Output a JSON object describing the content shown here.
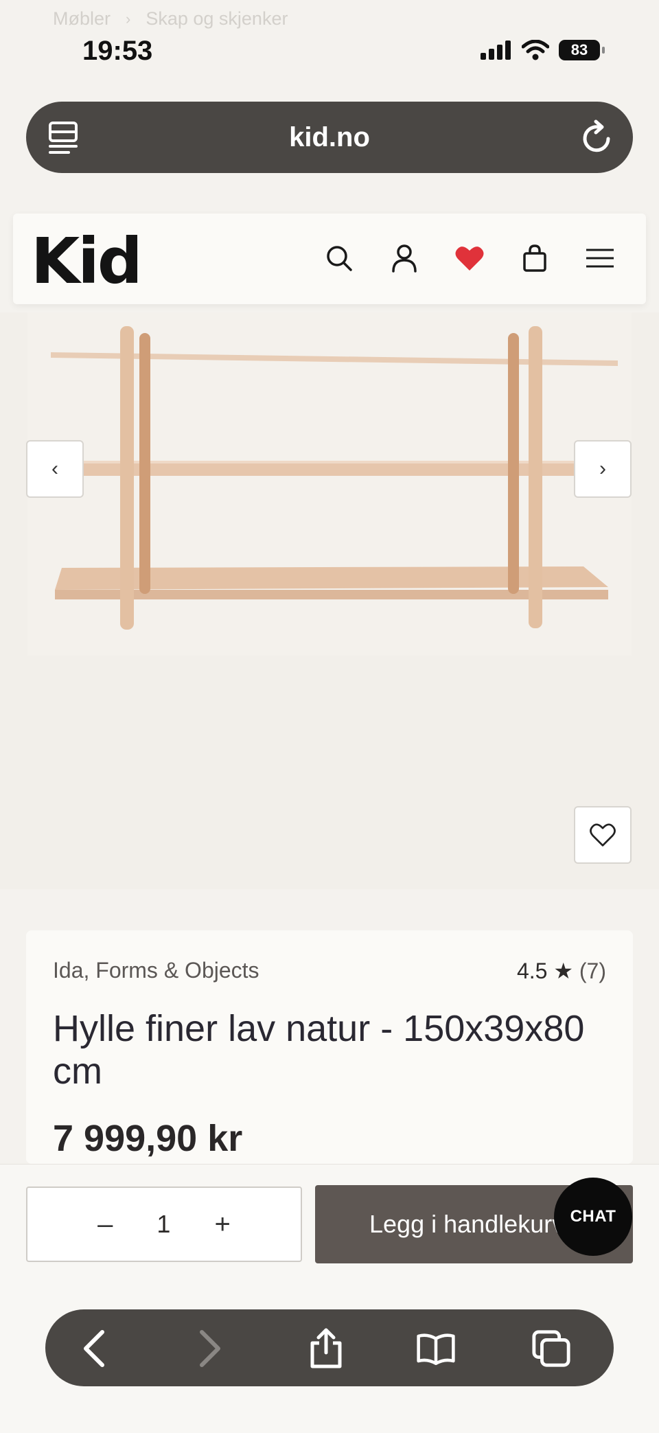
{
  "breadcrumb": {
    "items": [
      "Møbler",
      "Skap og skjenker"
    ],
    "separator": "›"
  },
  "status_bar": {
    "time": "19:53",
    "battery": "83"
  },
  "browser": {
    "url": "kid.no"
  },
  "site_header": {
    "logo": "Kid",
    "icons": [
      "search-icon",
      "account-icon",
      "heart-icon",
      "bag-icon",
      "menu-icon"
    ],
    "heart_color": "#e0323a"
  },
  "gallery": {
    "prev_label": "‹",
    "next_label": "›"
  },
  "product": {
    "brand": "Ida, Forms & Objects",
    "rating_value": "4.5 ★",
    "rating_count": "(7)",
    "title": "Hylle finer lav natur - 150x39x80 cm",
    "price": "7 999,90 kr"
  },
  "purchase": {
    "minus": "–",
    "quantity": "1",
    "plus": "+",
    "add_to_cart": "Legg i handlekurv",
    "chat": "CHAT"
  },
  "colors": {
    "accent_button": "#5e5753",
    "browser_bar": "#4a4744",
    "background": "#f4f2ee"
  }
}
